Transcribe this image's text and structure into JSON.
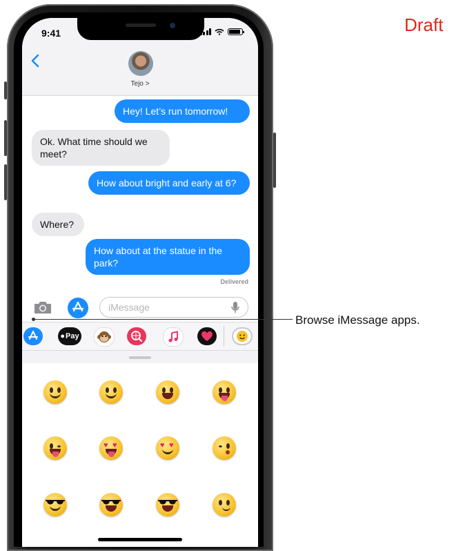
{
  "watermark": "Draft",
  "callout": "Browse iMessage apps.",
  "status": {
    "time": "9:41"
  },
  "header": {
    "contact_name": "Tejo >"
  },
  "messages": [
    {
      "from": "me",
      "text": "Hey! Let’s run tomorrow!"
    },
    {
      "from": "them",
      "text": "Ok. What time should we meet?"
    },
    {
      "from": "me",
      "text": "How about bright and early at 6?"
    },
    {
      "from": "them",
      "text": "Where?"
    },
    {
      "from": "me",
      "text": "How about at the statue in the park?"
    }
  ],
  "delivered_label": "Delivered",
  "input": {
    "placeholder": "iMessage"
  },
  "apps": [
    {
      "name": "App Store",
      "icon": "appstore-icon"
    },
    {
      "name": "Apple Pay",
      "label": "Pay",
      "icon": "apple-pay-icon"
    },
    {
      "name": "Animoji",
      "icon": "monkey-icon"
    },
    {
      "name": "Images",
      "icon": "globe-search-icon"
    },
    {
      "name": "Music",
      "icon": "music-note-icon"
    },
    {
      "name": "Digital Touch",
      "icon": "heart-icon"
    },
    {
      "name": "Memoji Stickers",
      "icon": "smiley-icon"
    }
  ],
  "colors": {
    "bubble_out": "#1a8cff",
    "bubble_in": "#e9e9eb",
    "draft": "#e0281b"
  },
  "stickers": [
    "smile",
    "smile",
    "grin",
    "tongue",
    "tongue-wink",
    "heart-eyes",
    "heart-eyes",
    "wink-kiss",
    "sunglasses",
    "sunglasses",
    "sunglasses",
    "smirk"
  ]
}
